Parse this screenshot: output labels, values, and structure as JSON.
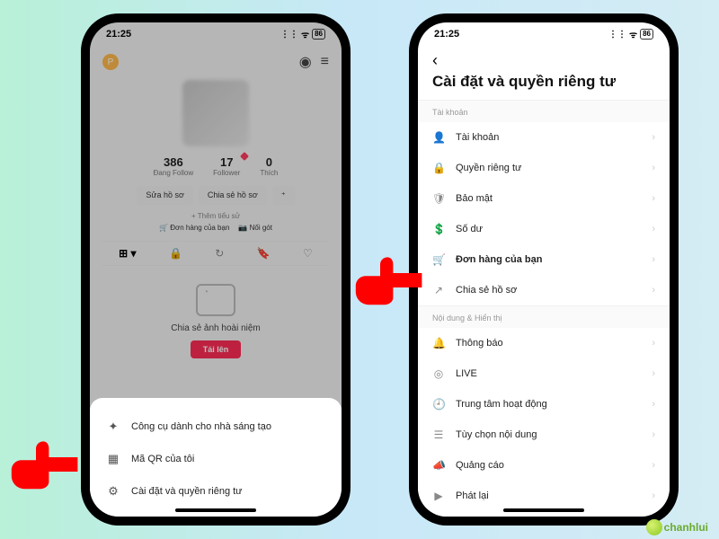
{
  "status": {
    "time": "21:25",
    "battery": "86"
  },
  "left": {
    "stats": {
      "following_num": "386",
      "following_lbl": "Đang Follow",
      "follower_num": "17",
      "follower_lbl": "Follower",
      "likes_num": "0",
      "likes_lbl": "Thích"
    },
    "edit_btn": "Sửa hồ sơ",
    "share_btn": "Chia sẻ hồ sơ",
    "add_bio": "+ Thêm tiểu sử",
    "orders_link": "Đơn hàng của bạn",
    "noigot_link": "Nối gót",
    "empty_title": "Chia sẻ ảnh hoài niệm",
    "upload_btn": "Tải lên",
    "sheet": {
      "creator_tools": "Công cụ dành cho nhà sáng tạo",
      "my_qr": "Mã QR của tôi",
      "settings_privacy": "Cài đặt và quyền riêng tư"
    }
  },
  "right": {
    "title": "Cài đặt và quyền riêng tư",
    "sec_account": "Tài khoản",
    "sec_content": "Nội dung & Hiển thị",
    "items": {
      "account": "Tài khoản",
      "privacy": "Quyền riêng tư",
      "security": "Bảo mật",
      "balance": "Số dư",
      "orders": "Đơn hàng của bạn",
      "share_profile": "Chia sẻ hồ sơ",
      "notifications": "Thông báo",
      "live": "LIVE",
      "activity_center": "Trung tâm hoạt động",
      "content_prefs": "Tùy chọn nội dung",
      "ads": "Quảng cáo",
      "playback": "Phát lại"
    }
  },
  "watermark": "chanhlui"
}
